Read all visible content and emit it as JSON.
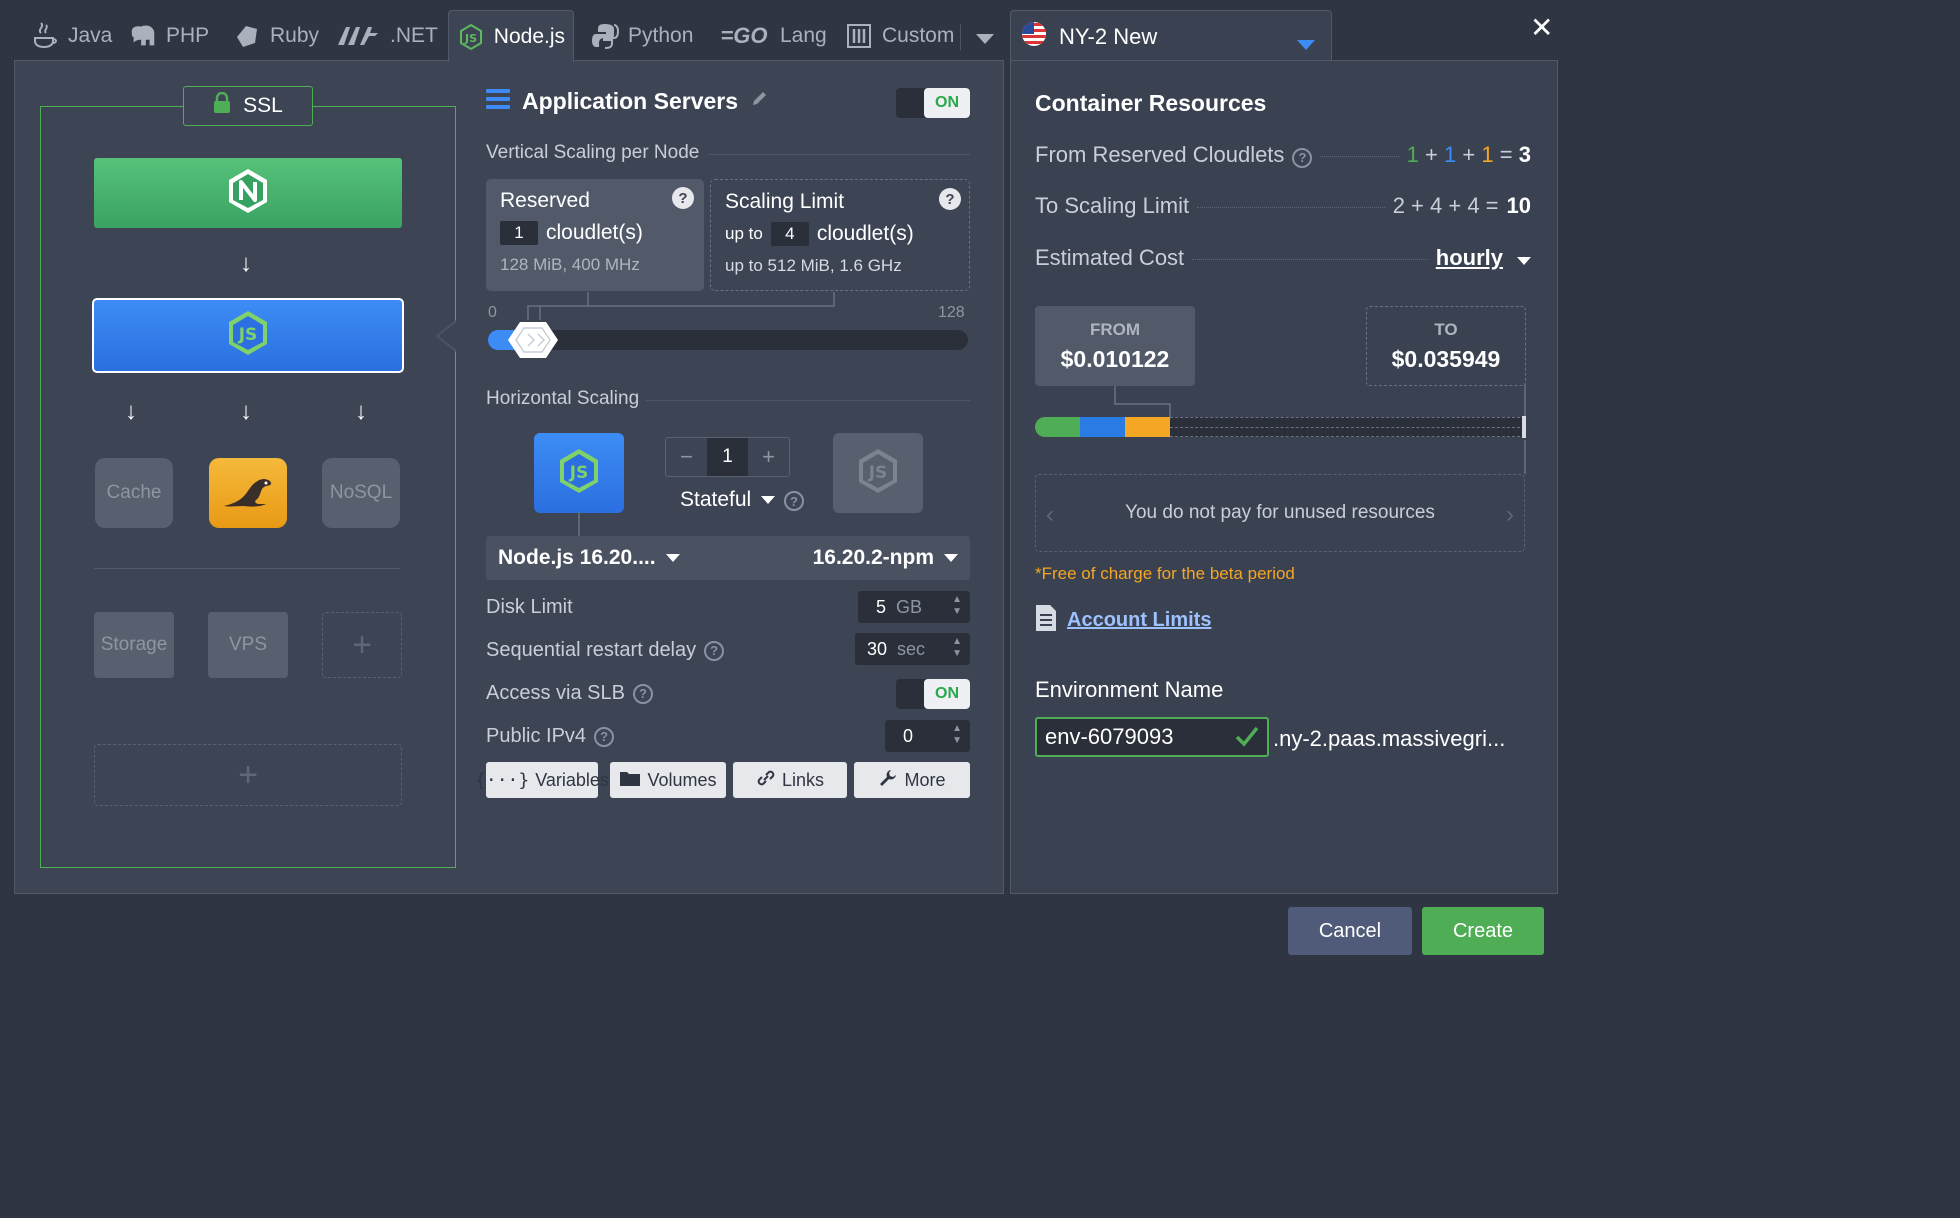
{
  "tabs": [
    {
      "label": "Java",
      "icon": "java-icon"
    },
    {
      "label": "PHP",
      "icon": "php-elephant-icon"
    },
    {
      "label": "Ruby",
      "icon": "ruby-icon"
    },
    {
      "label": ".NET",
      "icon": "dotnet-icon"
    },
    {
      "label": "Node.js",
      "icon": "nodejs-icon",
      "active": true
    },
    {
      "label": "Python",
      "icon": "python-icon"
    },
    {
      "label": "Lang",
      "icon": "go-icon"
    },
    {
      "label": "Custom",
      "icon": "custom-icon"
    }
  ],
  "region": {
    "label": "NY-2 New",
    "icon": "us-flag-icon"
  },
  "topology": {
    "ssl_label": "SSL",
    "cache_label": "Cache",
    "nosql_label": "NoSQL",
    "storage_label": "Storage",
    "vps_label": "VPS",
    "add_glyph": "+"
  },
  "app_servers": {
    "title": "Application Servers",
    "toggle": "ON",
    "vertical_label": "Vertical Scaling per Node",
    "reserved": {
      "title": "Reserved",
      "value": "1",
      "unit": "cloudlet(s)",
      "sub": "128 MiB, 400 MHz"
    },
    "scaling_limit": {
      "title": "Scaling Limit",
      "prefix": "up to",
      "value": "4",
      "unit": "cloudlet(s)",
      "sub": "up to 512 MiB, 1.6 GHz"
    },
    "slider_min": "0",
    "slider_max": "128",
    "horizontal_label": "Horizontal Scaling",
    "node_count": "1",
    "minus": "−",
    "plus": "+",
    "stateful_label": "Stateful",
    "engine_select": "Node.js 16.20....",
    "version_select": "16.20.2-npm",
    "disk_label": "Disk Limit",
    "disk_value": "5",
    "disk_unit": "GB",
    "restart_label": "Sequential restart delay",
    "restart_value": "30",
    "restart_unit": "sec",
    "slb_label": "Access via SLB",
    "slb_toggle": "ON",
    "ipv4_label": "Public IPv4",
    "ipv4_value": "0",
    "buttons": {
      "variables": "Variables",
      "volumes": "Volumes",
      "links": "Links",
      "more": "More"
    }
  },
  "resources": {
    "title": "Container Resources",
    "from_label": "From Reserved Cloudlets",
    "from_parts": [
      "1",
      "+",
      "1",
      "+",
      "1",
      "=",
      "3"
    ],
    "to_label": "To Scaling Limit",
    "to_formula": "2 + 4 + 4 =",
    "to_total": "10",
    "cost_label": "Estimated Cost",
    "cost_period": "hourly",
    "from_caption": "FROM",
    "from_price": "$0.010122",
    "to_caption": "TO",
    "to_price": "$0.035949",
    "note": "You do not pay for unused resources",
    "beta_note": "*Free of charge for the beta period",
    "account_limits": "Account Limits",
    "env_name_label": "Environment Name",
    "env_name": "env-6079093",
    "domain_suffix": ".ny-2.paas.massivegri..."
  },
  "footer": {
    "cancel": "Cancel",
    "create": "Create"
  },
  "colors": {
    "green": "#4fae55",
    "blue": "#2b7be5",
    "orange": "#f5a623",
    "accent_green_btn": "#4fae55"
  }
}
